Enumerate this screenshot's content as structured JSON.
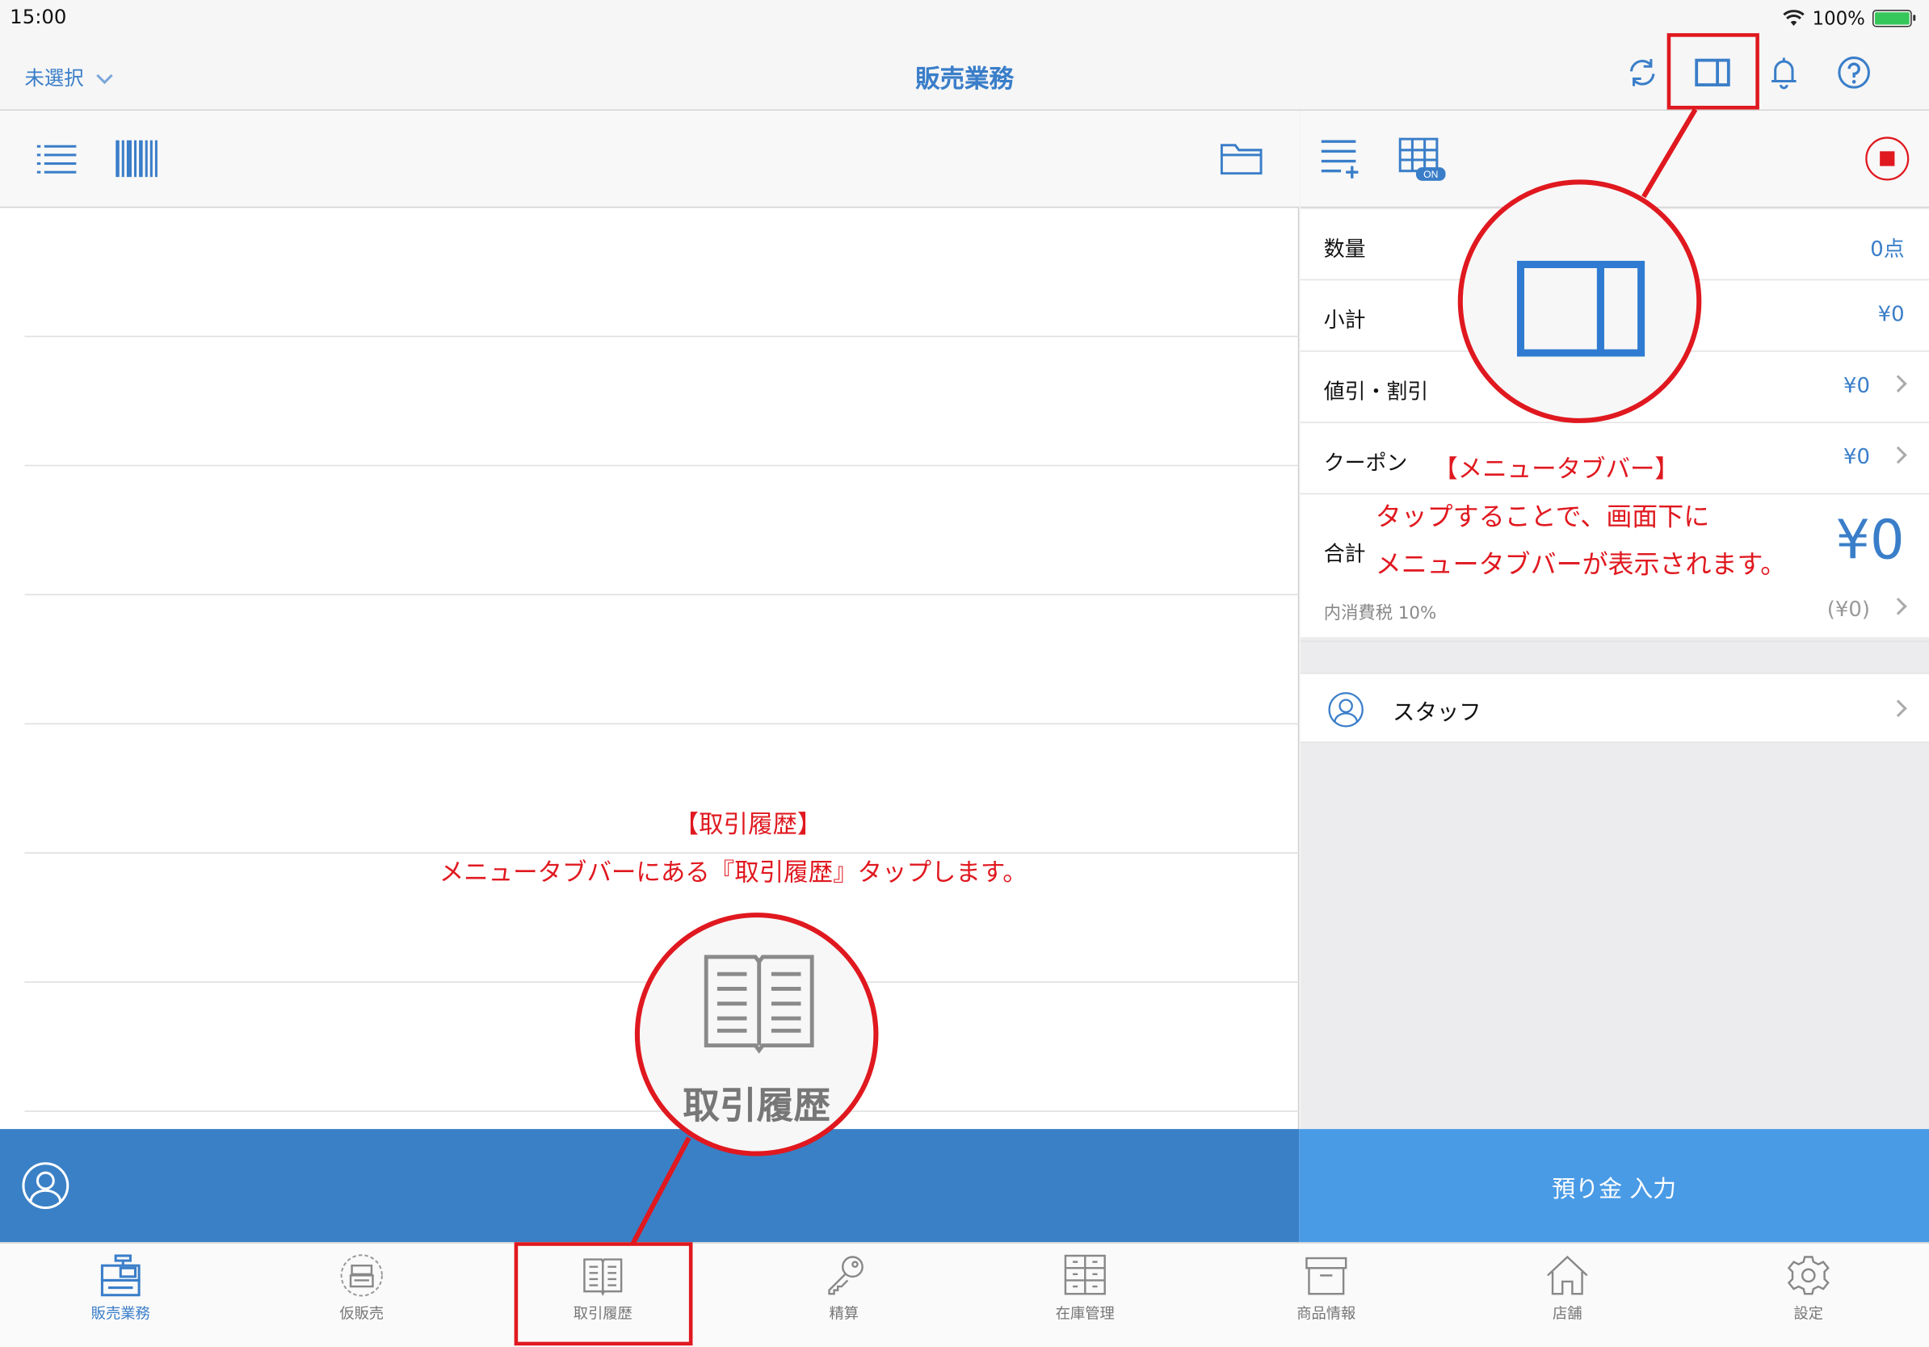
{
  "status": {
    "time": "15:00",
    "battery": "100%"
  },
  "nav": {
    "store_selector": "未選択",
    "title": "販売業務"
  },
  "summary": {
    "qty_label": "数量",
    "qty_value": "0点",
    "subtotal_label": "小計",
    "subtotal_value": "¥0",
    "discount_label": "値引・割引",
    "discount_value": "¥0",
    "coupon_label": "クーポン",
    "coupon_value": "¥0",
    "total_label": "合計",
    "total_value": "¥0",
    "tax_label": "内消費税 10%",
    "tax_value": "(¥0)"
  },
  "staff": {
    "label": "スタッフ"
  },
  "deposit": {
    "label": "預り金 入力"
  },
  "tabs": [
    {
      "label": "販売業務",
      "icon": "register-icon"
    },
    {
      "label": "仮販売",
      "icon": "temp-sale-icon"
    },
    {
      "label": "取引履歴",
      "icon": "book-icon"
    },
    {
      "label": "精算",
      "icon": "key-icon"
    },
    {
      "label": "在庫管理",
      "icon": "inventory-icon"
    },
    {
      "label": "商品情報",
      "icon": "box-icon"
    },
    {
      "label": "店舗",
      "icon": "home-icon"
    },
    {
      "label": "設定",
      "icon": "gear-icon"
    }
  ],
  "annotations": {
    "menu_title": "【メニュータブバー】",
    "menu_line1": "タップすることで、画面下に",
    "menu_line2": "メニュータブバーが表示されます。",
    "history_title": "【取引履歴】",
    "history_line1": "メニュータブバーにある『取引履歴』タップします。",
    "history_zoom_label": "取引履歴"
  },
  "colors": {
    "accent": "#3a7ec9",
    "annotation": "#e0181f",
    "bottom_bar": "#3a80c6",
    "deposit_button": "#4a9be6"
  }
}
